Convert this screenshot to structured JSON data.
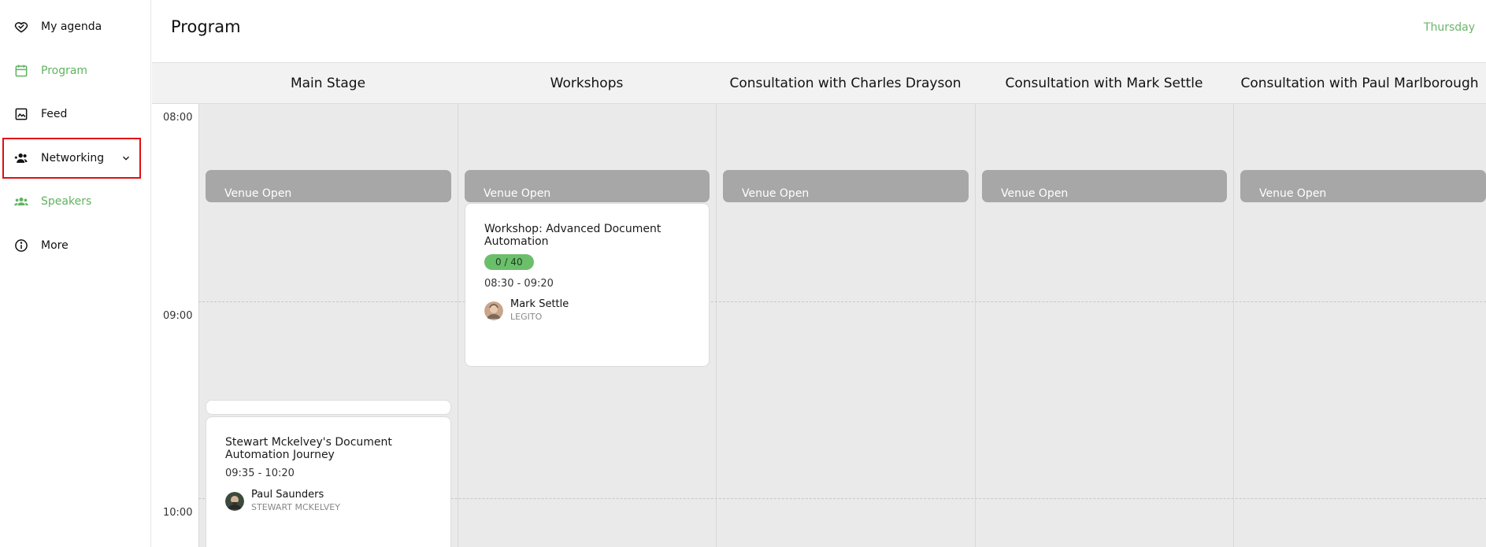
{
  "sidebar": {
    "items": [
      {
        "label": "My agenda",
        "icon": "heart-icon"
      },
      {
        "label": "Program",
        "icon": "calendar-icon",
        "active": true
      },
      {
        "label": "Feed",
        "icon": "image-icon"
      },
      {
        "label": "Networking",
        "icon": "people-add-icon",
        "has_submenu": true
      },
      {
        "label": "Speakers",
        "icon": "group-icon"
      },
      {
        "label": "More",
        "icon": "info-icon"
      }
    ]
  },
  "header": {
    "title": "Program",
    "day": "Thursday"
  },
  "columns": [
    "Main Stage",
    "Workshops",
    "Consultation with Charles Drayson",
    "Consultation with Mark Settle",
    "Consultation with Paul Marlborough"
  ],
  "times": [
    "08:00",
    "09:00",
    "10:00"
  ],
  "venue_label": "Venue Open",
  "sessions": {
    "workshop": {
      "title": "Workshop: Advanced Document Automation",
      "capacity": "0 / 40",
      "time": "08:30 - 09:20",
      "speaker_name": "Mark Settle",
      "speaker_org": "LEGITO"
    },
    "main": {
      "title": "Stewart Mckelvey's Document Automation Journey",
      "time": "09:35 - 10:20",
      "speaker_name": "Paul Saunders",
      "speaker_org": "STEWART MCKELVEY"
    }
  },
  "colors": {
    "accent": "#5fb35f",
    "highlight_outline": "#e01010",
    "venue_block": "#a6a7a6",
    "track_bg": "#e9eae9"
  }
}
